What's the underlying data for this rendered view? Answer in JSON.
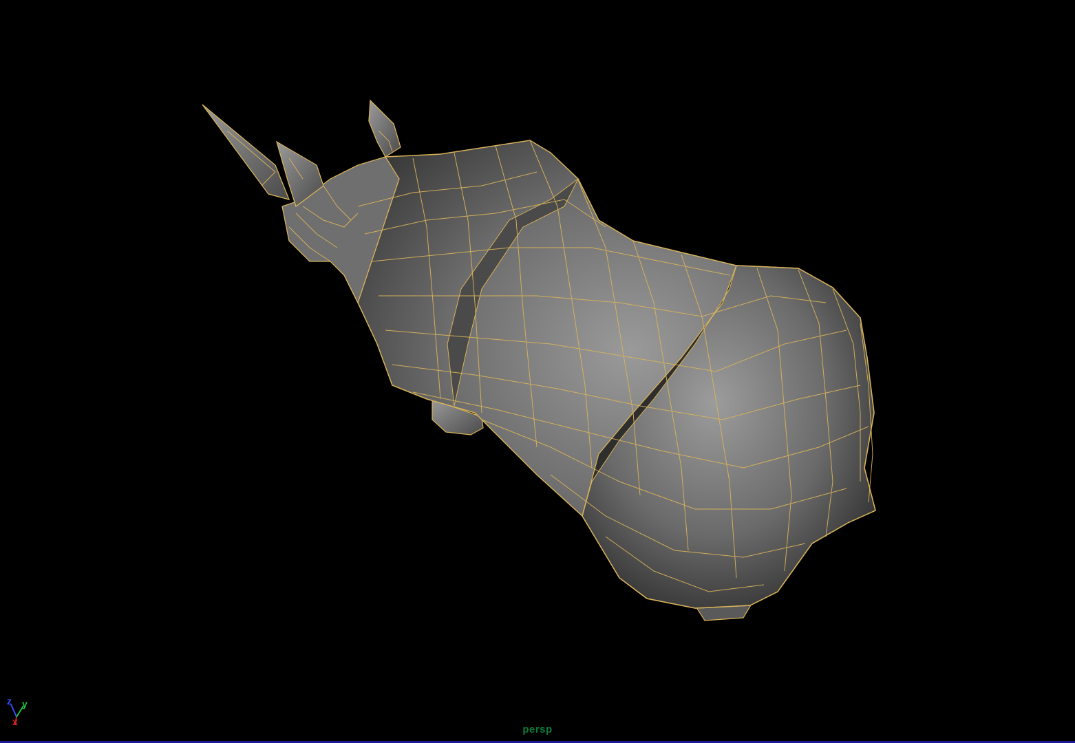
{
  "viewport": {
    "camera_label": "persp",
    "background_color": "#000000",
    "wireframe_color": "#d8b35a",
    "shade_color": "#8a8a8a",
    "label_color": "#0c7a3a"
  },
  "axis_gizmo": {
    "x_label": "x",
    "y_label": "y",
    "z_label": "z",
    "x_color": "#d42020",
    "y_color": "#20c040",
    "z_color": "#3050ff"
  },
  "model": {
    "icon": "rhino-wireframe-mesh"
  }
}
